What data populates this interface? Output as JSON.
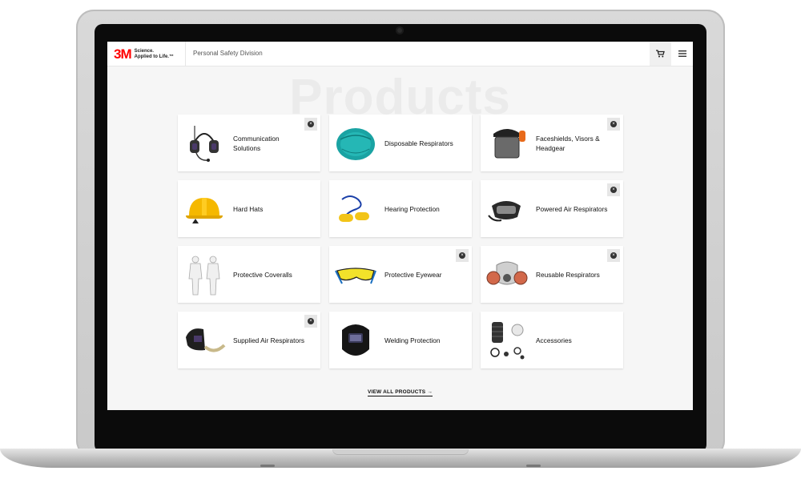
{
  "header": {
    "logo_mark": "3M",
    "logo_tag_line1": "Science.",
    "logo_tag_line2": "Applied to Life.™",
    "division": "Personal Safety Division"
  },
  "watermark": "Products",
  "products": [
    {
      "label": "Communication Solutions",
      "icon": "headset-icon",
      "closable": true
    },
    {
      "label": "Disposable Respirators",
      "icon": "disposable-respirator-icon",
      "closable": false
    },
    {
      "label": "Faceshields, Visors & Headgear",
      "icon": "faceshield-icon",
      "closable": true
    },
    {
      "label": "Hard Hats",
      "icon": "hard-hat-icon",
      "closable": false
    },
    {
      "label": "Hearing Protection",
      "icon": "earplugs-icon",
      "closable": false
    },
    {
      "label": "Powered Air Respirators",
      "icon": "powered-respirator-icon",
      "closable": true
    },
    {
      "label": "Protective Coveralls",
      "icon": "coveralls-icon",
      "closable": false
    },
    {
      "label": "Protective Eyewear",
      "icon": "safety-glasses-icon",
      "closable": true
    },
    {
      "label": "Reusable Respirators",
      "icon": "reusable-respirator-icon",
      "closable": true
    },
    {
      "label": "Supplied Air Respirators",
      "icon": "supplied-air-helmet-icon",
      "closable": true
    },
    {
      "label": "Welding Protection",
      "icon": "welding-helmet-icon",
      "closable": false
    },
    {
      "label": "Accessories",
      "icon": "accessories-icon",
      "closable": false
    }
  ],
  "view_all": "VIEW ALL PRODUCTS →",
  "colors": {
    "brand": "#ff0000",
    "background": "#f6f6f6"
  }
}
